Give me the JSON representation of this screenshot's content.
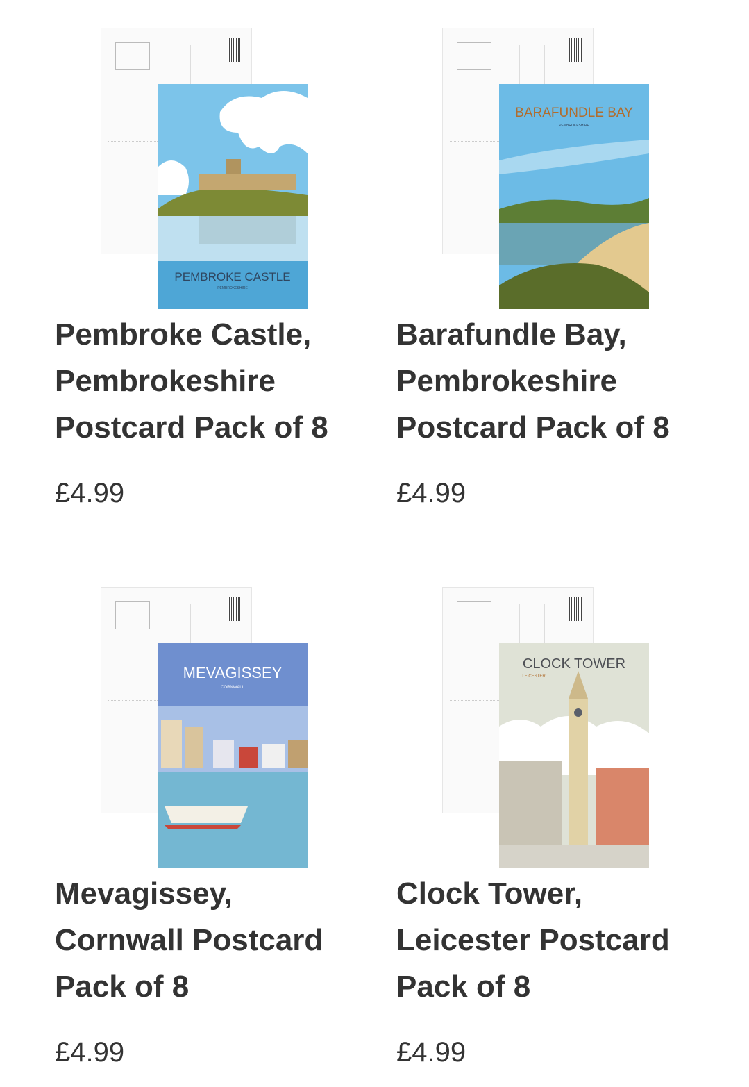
{
  "products": [
    {
      "title": "Pembroke Castle, Pembrokeshire Postcard Pack of 8",
      "price": "£4.99",
      "poster_heading": "PEMBROKE CASTLE",
      "poster_sub": "PEMBROKESHIRE"
    },
    {
      "title": "Barafundle Bay, Pembrokeshire Postcard Pack of 8",
      "price": "£4.99",
      "poster_heading": "BARAFUNDLE BAY",
      "poster_sub": "PEMBROKESHIRE"
    },
    {
      "title": "Mevagissey, Cornwall Postcard Pack of 8",
      "price": "£4.99",
      "poster_heading": "MEVAGISSEY",
      "poster_sub": "CORNWALL"
    },
    {
      "title": "Clock Tower, Leicester Postcard Pack of 8",
      "price": "£4.99",
      "poster_heading": "CLOCK TOWER",
      "poster_sub": "LEICESTER"
    }
  ]
}
